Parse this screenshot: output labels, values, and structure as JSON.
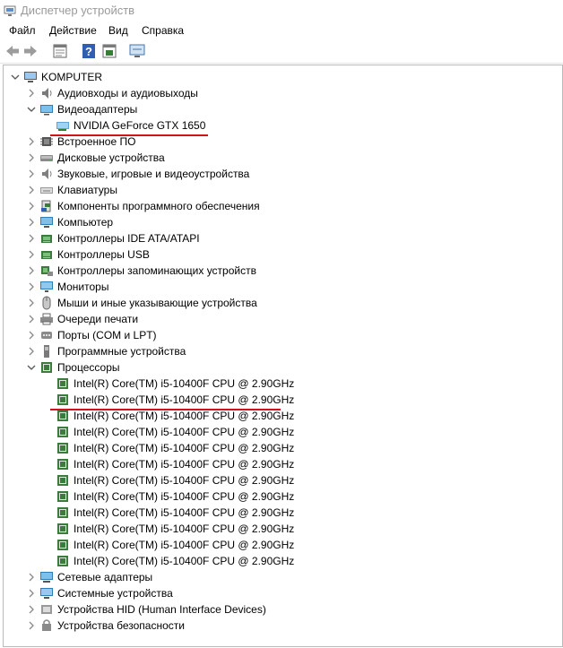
{
  "window": {
    "title": "Диспетчер устройств"
  },
  "menu": [
    "Файл",
    "Действие",
    "Вид",
    "Справка"
  ],
  "toolbar": {
    "buttons": [
      "back-icon",
      "forward-icon",
      "properties-icon",
      "help-icon",
      "show-hidden-icon",
      "monitor-scan-icon"
    ]
  },
  "tree": {
    "root": "KOMPUTER",
    "categories": [
      {
        "label": "Аудиовходы и аудиовыходы",
        "icon": "speaker-icon",
        "expanded": false
      },
      {
        "label": "Видеоадаптеры",
        "icon": "display-adapter-icon",
        "expanded": true,
        "children": [
          "NVIDIA GeForce GTX 1650"
        ]
      },
      {
        "label": "Встроенное ПО",
        "icon": "firmware-icon",
        "expanded": false
      },
      {
        "label": "Дисковые устройства",
        "icon": "disk-drive-icon",
        "expanded": false
      },
      {
        "label": "Звуковые, игровые и видеоустройства",
        "icon": "sound-icon",
        "expanded": false
      },
      {
        "label": "Клавиатуры",
        "icon": "keyboard-icon",
        "expanded": false
      },
      {
        "label": "Компоненты программного обеспечения",
        "icon": "software-component-icon",
        "expanded": false
      },
      {
        "label": "Компьютер",
        "icon": "computer-icon",
        "expanded": false
      },
      {
        "label": "Контроллеры IDE ATA/ATAPI",
        "icon": "ide-controller-icon",
        "expanded": false
      },
      {
        "label": "Контроллеры USB",
        "icon": "usb-icon",
        "expanded": false
      },
      {
        "label": "Контроллеры запоминающих устройств",
        "icon": "storage-controller-icon",
        "expanded": false
      },
      {
        "label": "Мониторы",
        "icon": "monitor-icon",
        "expanded": false
      },
      {
        "label": "Мыши и иные указывающие устройства",
        "icon": "mouse-icon",
        "expanded": false
      },
      {
        "label": "Очереди печати",
        "icon": "printer-icon",
        "expanded": false
      },
      {
        "label": "Порты (COM и LPT)",
        "icon": "port-icon",
        "expanded": false
      },
      {
        "label": "Программные устройства",
        "icon": "software-device-icon",
        "expanded": false
      },
      {
        "label": "Процессоры",
        "icon": "processor-icon",
        "expanded": true,
        "children": [
          "Intel(R) Core(TM) i5-10400F CPU @ 2.90GHz",
          "Intel(R) Core(TM) i5-10400F CPU @ 2.90GHz",
          "Intel(R) Core(TM) i5-10400F CPU @ 2.90GHz",
          "Intel(R) Core(TM) i5-10400F CPU @ 2.90GHz",
          "Intel(R) Core(TM) i5-10400F CPU @ 2.90GHz",
          "Intel(R) Core(TM) i5-10400F CPU @ 2.90GHz",
          "Intel(R) Core(TM) i5-10400F CPU @ 2.90GHz",
          "Intel(R) Core(TM) i5-10400F CPU @ 2.90GHz",
          "Intel(R) Core(TM) i5-10400F CPU @ 2.90GHz",
          "Intel(R) Core(TM) i5-10400F CPU @ 2.90GHz",
          "Intel(R) Core(TM) i5-10400F CPU @ 2.90GHz",
          "Intel(R) Core(TM) i5-10400F CPU @ 2.90GHz"
        ]
      },
      {
        "label": "Сетевые адаптеры",
        "icon": "network-adapter-icon",
        "expanded": false
      },
      {
        "label": "Системные устройства",
        "icon": "system-device-icon",
        "expanded": false
      },
      {
        "label": "Устройства HID (Human Interface Devices)",
        "icon": "hid-icon",
        "expanded": false
      },
      {
        "label": "Устройства безопасности",
        "icon": "security-device-icon",
        "expanded": false
      }
    ]
  },
  "highlights": [
    "NVIDIA GeForce GTX 1650",
    "Intel(R) Core(TM) i5-10400F CPU @ 2.90GHz"
  ],
  "colors": {
    "highlight_underline": "#d0121b",
    "title_text": "#9a9a9a",
    "border": "#b9b9b9"
  }
}
